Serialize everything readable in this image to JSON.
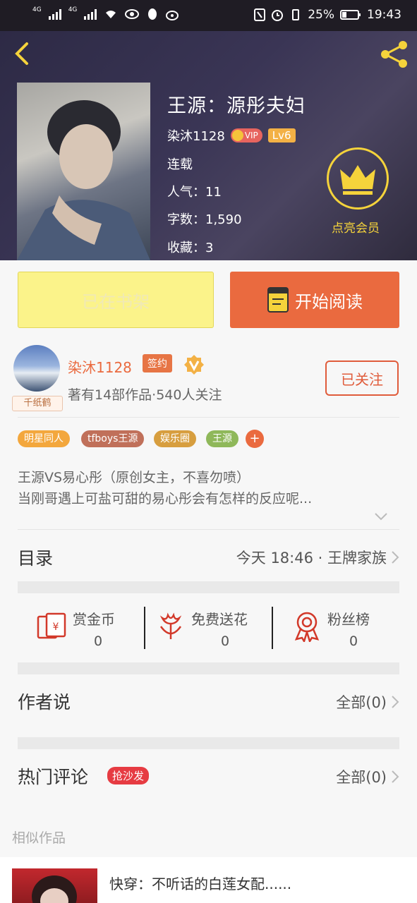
{
  "status_bar": {
    "net1": "4G",
    "net2": "4G",
    "battery": "25%",
    "time": "19:43"
  },
  "book": {
    "title": "王源：源彤夫妇",
    "author": "染沐1128",
    "vip_label": "VIP",
    "level": "Lv6",
    "status": "连载",
    "popularity": "人气：11",
    "word_count": "字数：1,590",
    "favorites": "收藏：3",
    "member_label": "点亮会员"
  },
  "actions": {
    "on_shelf": "已在书架",
    "start_reading": "开始阅读"
  },
  "author": {
    "avatar_tag": "千纸鹤",
    "name": "染沐1128",
    "sign_badge": "签约",
    "stats": "著有14部作品·540人关注",
    "follow_button": "已关注"
  },
  "tags": [
    {
      "label": "明星同人",
      "color": "#f3a73d"
    },
    {
      "label": "tfboys王源",
      "color": "#c0705a"
    },
    {
      "label": "娱乐圈",
      "color": "#d79e3f"
    },
    {
      "label": "王源",
      "color": "#8fb85a"
    }
  ],
  "tag_more": "+",
  "description": {
    "line1": "王源VS易心彤（原创女主，不喜勿喷）",
    "line2": "当刚哥遇上可盐可甜的易心彤会有怎样的反应呢..."
  },
  "catalog": {
    "title": "目录",
    "latest": "今天 18:46 · 王牌家族"
  },
  "rewards": [
    {
      "label": "赏金币",
      "count": "0",
      "icon": "coin-envelope-icon"
    },
    {
      "label": "免费送花",
      "count": "0",
      "icon": "flower-icon"
    },
    {
      "label": "粉丝榜",
      "count": "0",
      "icon": "ribbon-medal-icon"
    }
  ],
  "author_says": {
    "title": "作者说",
    "all": "全部(0)"
  },
  "hot_comments": {
    "title": "热门评论",
    "badge": "抢沙发",
    "all": "全部(0)"
  },
  "similar": {
    "heading": "相似作品",
    "first_title": "快穿：不听话的白莲女配......"
  },
  "colors": {
    "accent": "#ea6a3f",
    "gold": "#f5d33b",
    "hero_bg": "#2d2a45"
  }
}
